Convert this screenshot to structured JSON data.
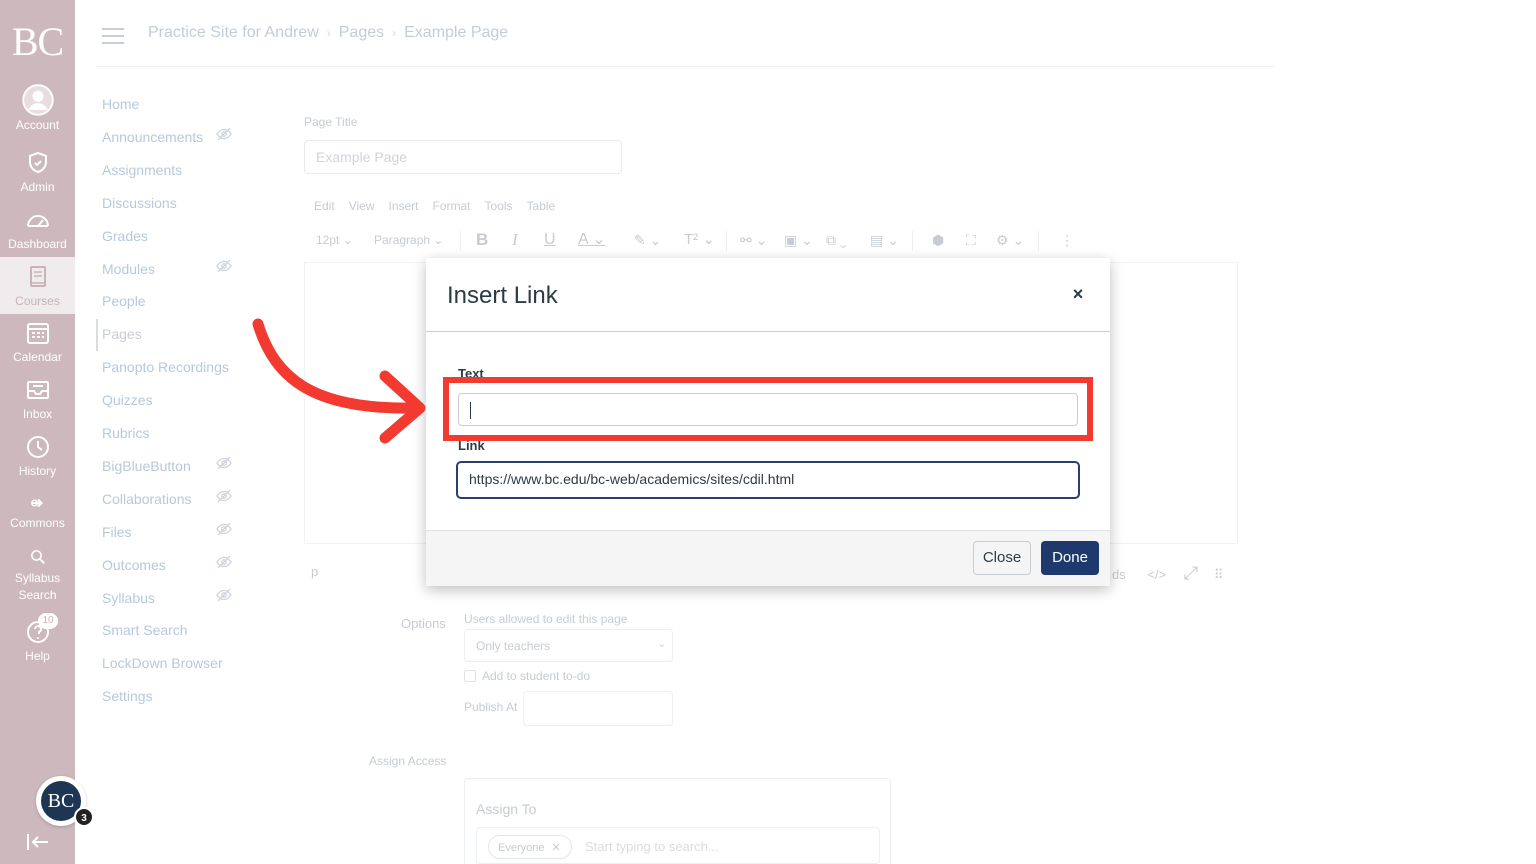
{
  "global_nav": {
    "logo": "BC",
    "items": [
      {
        "label": "Account",
        "icon": "user-circle-icon"
      },
      {
        "label": "Admin",
        "icon": "shield-icon"
      },
      {
        "label": "Dashboard",
        "icon": "dashboard-gauge-icon"
      },
      {
        "label": "Courses",
        "icon": "book-icon"
      },
      {
        "label": "Calendar",
        "icon": "calendar-icon"
      },
      {
        "label": "Inbox",
        "icon": "inbox-icon"
      },
      {
        "label": "History",
        "icon": "clock-icon"
      },
      {
        "label": "Commons",
        "icon": "commons-icon"
      },
      {
        "label": "Syllabus Search",
        "label_line1": "Syllabus",
        "label_line2": "Search",
        "icon": "search-icon"
      },
      {
        "label": "Help",
        "icon": "help-icon",
        "badge": "10"
      }
    ],
    "avatar_initials": "BC",
    "avatar_badge": "3"
  },
  "breadcrumb": {
    "items": [
      "Practice Site for Andrew",
      "Pages",
      "Example Page"
    ],
    "separator": "›"
  },
  "course_nav": {
    "items": [
      {
        "label": "Home",
        "hidden": false
      },
      {
        "label": "Announcements",
        "hidden": true
      },
      {
        "label": "Assignments",
        "hidden": false
      },
      {
        "label": "Discussions",
        "hidden": false
      },
      {
        "label": "Grades",
        "hidden": false
      },
      {
        "label": "Modules",
        "hidden": true
      },
      {
        "label": "People",
        "hidden": false
      },
      {
        "label": "Pages",
        "hidden": false,
        "active": true
      },
      {
        "label": "Panopto Recordings",
        "hidden": false
      },
      {
        "label": "Quizzes",
        "hidden": false
      },
      {
        "label": "Rubrics",
        "hidden": false
      },
      {
        "label": "BigBlueButton",
        "hidden": true
      },
      {
        "label": "Collaborations",
        "hidden": true
      },
      {
        "label": "Files",
        "hidden": true
      },
      {
        "label": "Outcomes",
        "hidden": true
      },
      {
        "label": "Syllabus",
        "hidden": true
      },
      {
        "label": "Smart Search",
        "hidden": false
      },
      {
        "label": "LockDown Browser",
        "hidden": false
      },
      {
        "label": "Settings",
        "hidden": false
      }
    ]
  },
  "editor": {
    "page_title_label": "Page Title",
    "page_title_value": "Example Page",
    "menubar": [
      "Edit",
      "View",
      "Insert",
      "Format",
      "Tools",
      "Table"
    ],
    "font_size": "12pt",
    "block_format": "Paragraph",
    "status_path": "p",
    "status_words": "ds",
    "html_toggle": "</>"
  },
  "options": {
    "label": "Options",
    "users_label": "Users allowed to edit this page",
    "users_value": "Only teachers",
    "todo_label": "Add to student to-do",
    "publish_label": "Publish At",
    "assign_access_label": "Assign Access",
    "assign_to_label": "Assign To",
    "assignee_chip": "Everyone",
    "assign_placeholder": "Start typing to search..."
  },
  "modal": {
    "title": "Insert Link",
    "close_symbol": "×",
    "text_label": "Text",
    "text_value": "",
    "link_label": "Link",
    "link_value": "https://www.bc.edu/bc-web/academics/sites/cdil.html",
    "close_button": "Close",
    "done_button": "Done"
  },
  "colors": {
    "global_nav_bg": "#cdb9bd",
    "primary_button": "#1e3a6d",
    "annotation_red": "#f23a30"
  }
}
